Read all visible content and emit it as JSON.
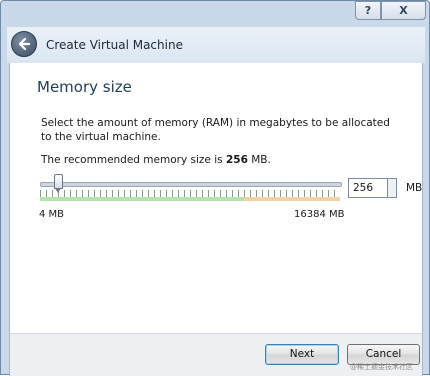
{
  "window": {
    "help_label": "?",
    "close_label": "X"
  },
  "titlebar": {
    "back_icon": "back-arrow-icon",
    "title": "Create Virtual Machine"
  },
  "page": {
    "heading": "Memory size",
    "description": "Select the amount of memory (RAM) in megabytes to be allocated to the virtual machine.",
    "recommend_prefix": "The recommended memory size is ",
    "recommend_value": "256",
    "recommend_suffix": " MB."
  },
  "memory": {
    "value": "256",
    "min_label": "4 MB",
    "max_label": "16384 MB",
    "unit": "MB",
    "min": 4,
    "max": 16384,
    "current": 256,
    "safe_fraction": 0.68
  },
  "footer": {
    "next_label": "Next",
    "cancel_label": "Cancel",
    "watermark": "@稀土掘金技术社区"
  },
  "colors": {
    "safe_zone": "#b9dfb4",
    "warn_zone": "#f2d4a4"
  }
}
